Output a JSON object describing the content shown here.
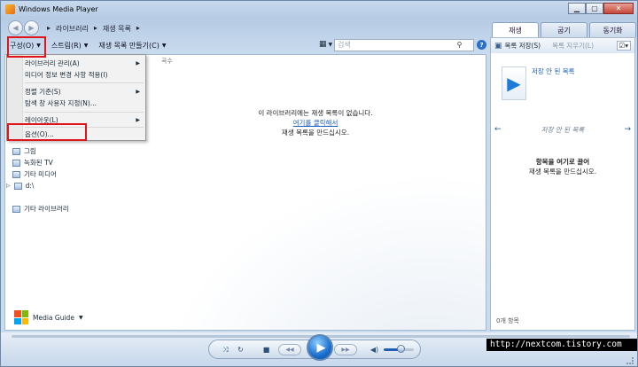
{
  "window": {
    "title": "Windows Media Player"
  },
  "breadcrumb": [
    "라이브러리",
    "재생 목록"
  ],
  "tabs": [
    "재생",
    "굽기",
    "동기화"
  ],
  "toolbar": {
    "organize": "구성(O)",
    "stream": "스트림(R)",
    "create_playlist": "재생 목록 만들기(C)"
  },
  "search": {
    "placeholder": "검색"
  },
  "column_header": "곡수",
  "empty_message": {
    "line1": "이 라이브러리에는 재생 목록이 없습니다.",
    "link": "여기를 클릭해서",
    "line3": "재생 목록을 만드십시오."
  },
  "menu": {
    "items": [
      "라이브러리 관리(A)",
      "미디어 정보 변경 사항 적용(I)",
      "정렬 기준(S)",
      "탐색 창 사용자 지정(N)...",
      "레이아웃(L)",
      "옵션(O)..."
    ]
  },
  "nav_tree": [
    "그림",
    "녹화된 TV",
    "기타 미디어",
    "d:\\",
    "기타 라이브러리"
  ],
  "media_guide": "Media Guide",
  "right_panel": {
    "save_list": "목록 저장(S)",
    "clear_list": "목록 지우기(L)",
    "unsaved_top": "저장 안 된 목록",
    "unsaved_nav": "저장 안 된 목록",
    "drag_bold": "항목을 여기로 끌어",
    "drag_text": "재생 목록을 만드십시오.",
    "count": "0개 항목"
  },
  "watermark": "http://nextcom.tistory.com",
  "volume_level": 0.6
}
